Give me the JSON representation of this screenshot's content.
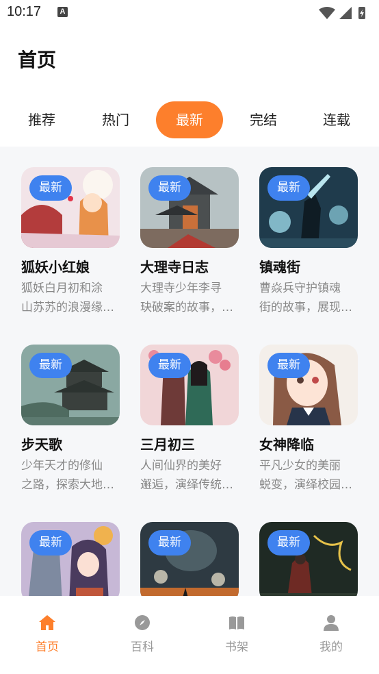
{
  "status": {
    "time": "10:17",
    "a_icon_text": "A"
  },
  "header": {
    "title": "首页"
  },
  "tabs": [
    {
      "label": "推荐",
      "active": false
    },
    {
      "label": "热门",
      "active": false
    },
    {
      "label": "最新",
      "active": true
    },
    {
      "label": "完结",
      "active": false
    },
    {
      "label": "连载",
      "active": false
    }
  ],
  "colors": {
    "accent": "#fd7f2c",
    "badge": "#3f82ef",
    "muted": "#999999"
  },
  "cards": [
    {
      "title": "狐妖小红娘",
      "desc": "狐妖白月初和涂\n山苏苏的浪漫缘…",
      "badge": "最新"
    },
    {
      "title": "大理寺日志",
      "desc": "大理寺少年李寻\n玦破案的故事，…",
      "badge": "最新"
    },
    {
      "title": "镇魂街",
      "desc": "曹焱兵守护镇魂\n街的故事，展现…",
      "badge": "最新"
    },
    {
      "title": "步天歌",
      "desc": "少年天才的修仙\n之路，探索大地…",
      "badge": "最新"
    },
    {
      "title": "三月初三",
      "desc": "人间仙界的美好\n邂逅，演绎传统…",
      "badge": "最新"
    },
    {
      "title": "女神降临",
      "desc": "平凡少女的美丽\n蜕变，演绎校园…",
      "badge": "最新"
    },
    {
      "title": "",
      "desc": "",
      "badge": "最新"
    },
    {
      "title": "",
      "desc": "",
      "badge": "最新"
    },
    {
      "title": "",
      "desc": "",
      "badge": "最新"
    }
  ],
  "nav": [
    {
      "label": "首页",
      "icon": "home-icon",
      "active": true
    },
    {
      "label": "百科",
      "icon": "compass-icon",
      "active": false
    },
    {
      "label": "书架",
      "icon": "book-icon",
      "active": false
    },
    {
      "label": "我的",
      "icon": "user-icon",
      "active": false
    }
  ]
}
